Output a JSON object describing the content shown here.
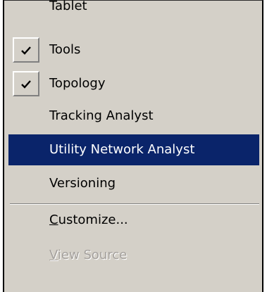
{
  "menu": {
    "items": [
      {
        "label": "Tablet",
        "checked": false
      },
      {
        "label": "Tools",
        "checked": true
      },
      {
        "label": "Topology",
        "checked": true
      },
      {
        "label": "Tracking Analyst",
        "checked": false
      },
      {
        "label": "Utility Network Analyst",
        "checked": false,
        "selected": true
      },
      {
        "label": "Versioning",
        "checked": false
      }
    ],
    "customize": {
      "mnemonic": "C",
      "rest": "ustomize..."
    },
    "view_source": {
      "mnemonic": "V",
      "rest": "iew Source",
      "disabled": true
    }
  },
  "colors": {
    "menu_background": "#d4d0c8",
    "selection_background": "#0a246a",
    "selection_text": "#ffffff",
    "disabled_text": "#a4a09c"
  },
  "icons": {
    "checkmark": "checkmark-icon"
  }
}
